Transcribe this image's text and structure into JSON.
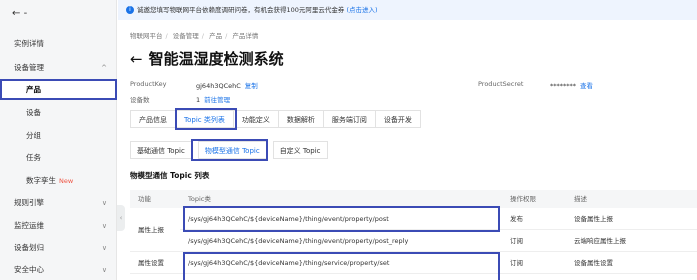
{
  "sidebar": {
    "back": "←",
    "back_sep": "-",
    "items": [
      {
        "label": "实例详情"
      },
      {
        "label": "设备管理",
        "chevron": "^"
      },
      {
        "label": "产品"
      },
      {
        "label": "设备"
      },
      {
        "label": "分组"
      },
      {
        "label": "任务"
      },
      {
        "label": "数字孪生",
        "badge": "New"
      },
      {
        "label": "规则引擎",
        "chevron": "∨"
      },
      {
        "label": "监控运维",
        "chevron": "∨"
      },
      {
        "label": "设备划归",
        "chevron": "∨"
      },
      {
        "label": "安全中心",
        "chevron": "∨"
      }
    ],
    "collapse": "‹"
  },
  "notice": {
    "text": "诚邀您填写物联网平台依赖度调研问卷，有机会获得100元阿里云代金券",
    "link": "(点击进入)"
  },
  "breadcrumb": [
    "物联网平台",
    "设备管理",
    "产品",
    "产品详情"
  ],
  "page": {
    "back_arrow": "←",
    "title": "智能温湿度检测系统"
  },
  "meta": {
    "product_key_label": "ProductKey",
    "product_key_value": "gj64h3QCehC",
    "copy_label": "复制",
    "device_count_label": "设备数",
    "device_count_value": "1",
    "device_link": "前往管理",
    "product_secret_label": "ProductSecret",
    "product_secret_value": "********",
    "view_label": "查看"
  },
  "tabs": [
    "产品信息",
    "Topic 类列表",
    "功能定义",
    "数据解析",
    "服务端订阅",
    "设备开发"
  ],
  "subtabs": [
    "基础通信 Topic",
    "物模型通信 Topic",
    "自定义 Topic"
  ],
  "section_title": "物模型通信 Topic 列表",
  "table": {
    "headers": {
      "function": "功能",
      "topic": "Topic类",
      "permission": "操作权限",
      "desc": "描述"
    },
    "rows": [
      {
        "group": "属性上报",
        "topic": "/sys/gj64h3QCehC/${deviceName}/thing/event/property/post",
        "permission": "发布",
        "desc": "设备属性上报"
      },
      {
        "group": "",
        "topic": "/sys/gj64h3QCehC/${deviceName}/thing/event/property/post_reply",
        "permission": "订阅",
        "desc": "云端响应属性上报"
      },
      {
        "group": "属性设置",
        "topic": "/sys/gj64h3QCehC/${deviceName}/thing/service/property/set",
        "permission": "订阅",
        "desc": "设备属性设置"
      }
    ]
  },
  "colors": {
    "accent": "#1a73e8",
    "highlight": "#3b4bb5",
    "new_badge": "#e54"
  }
}
